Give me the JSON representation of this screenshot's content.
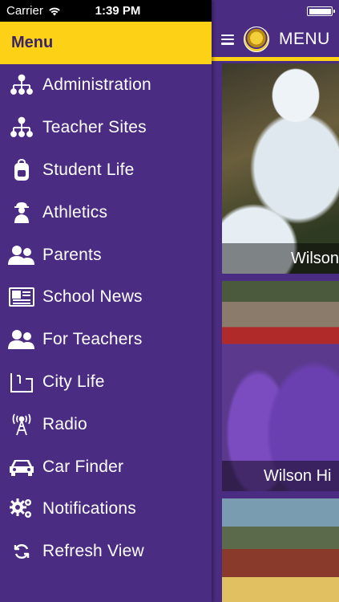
{
  "status_bar": {
    "carrier": "Carrier",
    "time": "1:39 PM"
  },
  "drawer": {
    "title": "Menu",
    "items": [
      {
        "label": "Administration",
        "icon": "org-chart-icon"
      },
      {
        "label": "Teacher Sites",
        "icon": "org-chart-icon"
      },
      {
        "label": "Student Life",
        "icon": "backpack-icon"
      },
      {
        "label": "Athletics",
        "icon": "coach-icon"
      },
      {
        "label": "Parents",
        "icon": "people-icon"
      },
      {
        "label": "School News",
        "icon": "newspaper-icon"
      },
      {
        "label": "For Teachers",
        "icon": "people-icon"
      },
      {
        "label": "City Life",
        "icon": "city-icon"
      },
      {
        "label": "Radio",
        "icon": "radio-tower-icon"
      },
      {
        "label": "Car Finder",
        "icon": "car-icon"
      },
      {
        "label": "Notifications",
        "icon": "gears-icon"
      },
      {
        "label": "Refresh View",
        "icon": "refresh-icon"
      }
    ]
  },
  "main": {
    "header_title": "MENU",
    "tiles": [
      {
        "caption": "Wilson"
      },
      {
        "caption": "Wilson Hi"
      },
      {
        "caption": ""
      }
    ]
  },
  "colors": {
    "brand_purple": "#4b2c83",
    "brand_gold": "#fcd116"
  }
}
